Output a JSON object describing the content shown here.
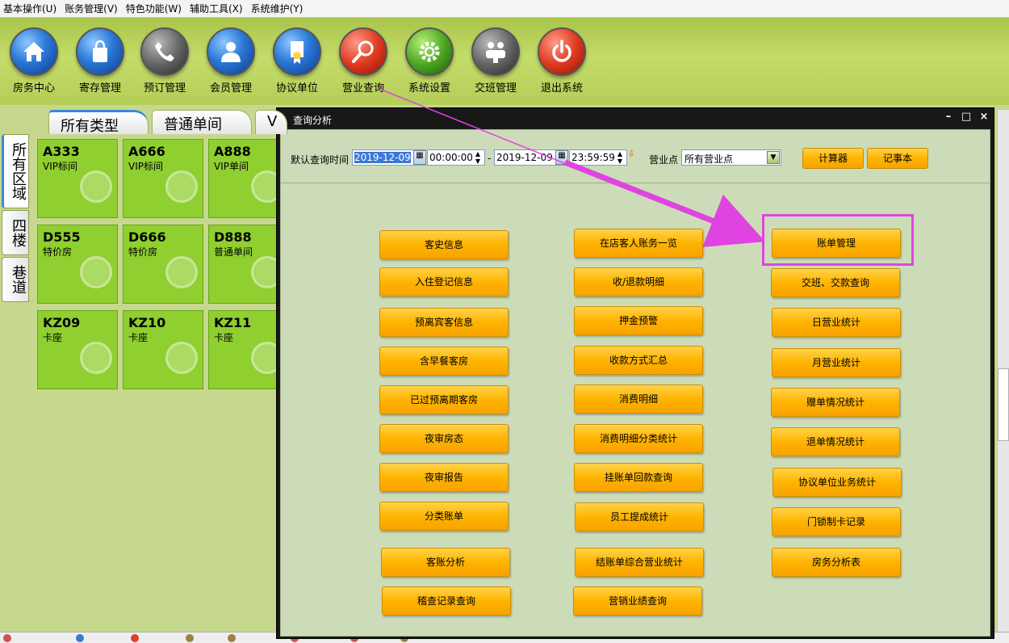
{
  "menu": [
    "基本操作(U)",
    "账务管理(V)",
    "特色功能(W)",
    "辅助工具(X)",
    "系统维护(Y)"
  ],
  "toolbar": {
    "items": [
      {
        "label": "房务中心",
        "icon": "home-icon",
        "color": "blue"
      },
      {
        "label": "寄存管理",
        "icon": "bag-icon",
        "color": "blue"
      },
      {
        "label": "预订管理",
        "icon": "phone-icon",
        "color": "gray"
      },
      {
        "label": "会员管理",
        "icon": "user-icon",
        "color": "blue"
      },
      {
        "label": "协议单位",
        "icon": "certificate-icon",
        "color": "blue"
      },
      {
        "label": "营业查询",
        "icon": "magnifier-icon",
        "color": "red"
      },
      {
        "label": "系统设置",
        "icon": "gear-icon",
        "color": "green"
      },
      {
        "label": "交班管理",
        "icon": "handover-icon",
        "color": "gray"
      },
      {
        "label": "退出系统",
        "icon": "power-icon",
        "color": "red"
      }
    ]
  },
  "area_tabs": [
    "所有区域",
    "四楼",
    "巷道"
  ],
  "type_tabs": [
    "所有类型",
    "普通单间",
    "V"
  ],
  "rooms": [
    {
      "name": "A333",
      "type": "VIP标间"
    },
    {
      "name": "A666",
      "type": "VIP标间"
    },
    {
      "name": "A888",
      "type": "VIP单间"
    },
    {
      "name": "D555",
      "type": "特价房"
    },
    {
      "name": "D666",
      "type": "特价房"
    },
    {
      "name": "D888",
      "type": "普通单间"
    },
    {
      "name": "KZ09",
      "type": "卡座"
    },
    {
      "name": "KZ10",
      "type": "卡座"
    },
    {
      "name": "KZ11",
      "type": "卡座"
    }
  ],
  "dialog": {
    "title": "查询分析",
    "query": {
      "label": "默认查询时间",
      "start_date": "2019-12-09",
      "start_time": "00:00:00",
      "separator": "-",
      "end_date": "2019-12-09",
      "end_time": "23:59:59",
      "point_label": "营业点",
      "point_value": "所有营业点",
      "calculator": "计算器",
      "notepad": "记事本"
    },
    "columns": [
      [
        "客史信息",
        "入住登记信息",
        "预离宾客信息",
        "含早餐客房",
        "已过预离期客房",
        "夜审房态",
        "夜审报告",
        "分类账单",
        "客账分析",
        "稽查记录查询"
      ],
      [
        "在店客人账务一览",
        "收/退款明细",
        "押金预警",
        "收款方式汇总",
        "消费明细",
        "消费明细分类统计",
        "挂账单回款查询",
        "员工提成统计",
        "结账单综合营业统计",
        "营销业绩查询"
      ],
      [
        "账单管理",
        "交班、交款查询",
        "日营业统计",
        "月营业统计",
        "赠单情况统计",
        "退单情况统计",
        "协议单位业务统计",
        "门锁制卡记录",
        "房务分析表"
      ]
    ]
  }
}
